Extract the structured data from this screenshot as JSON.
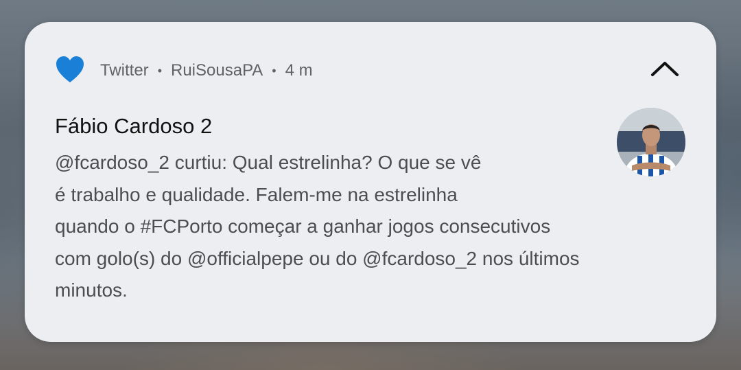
{
  "notification": {
    "app_name": "Twitter",
    "account": "RuiSousaPA",
    "time": "4 m",
    "separator": "•",
    "title": "Fábio Cardoso 2",
    "message_lines": [
      "@fcardoso_2 curtiu: Qual estrelinha? O que se vê",
      "é trabalho e qualidade. Falem-me na estrelinha",
      "quando o #FCPorto começar a ganhar jogos consecutivos",
      "com golo(s) do @officialpepe ou do @fcardoso_2 nos últimos",
      "minutos."
    ],
    "icons": {
      "app": "heart-icon",
      "collapse": "chevron-up-icon",
      "avatar": "avatar"
    },
    "colors": {
      "heart": "#1a7fd6",
      "card_background": "#eceef2",
      "title": "#111111",
      "body_text": "#4a4d52",
      "meta_text": "#5f6368"
    }
  }
}
